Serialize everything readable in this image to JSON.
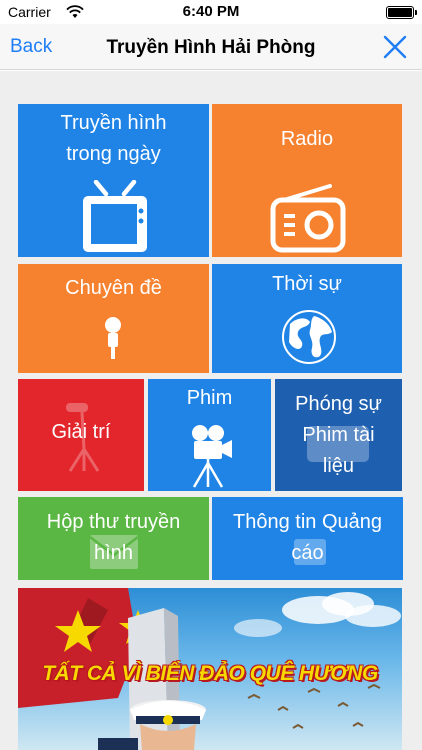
{
  "status_bar": {
    "carrier": "Carrier",
    "time": "6:40 PM"
  },
  "nav": {
    "back_label": "Back",
    "title": "Truyền Hình Hải Phòng",
    "close_icon": "close-icon"
  },
  "tiles": [
    {
      "id": "truyen-hinh-trong-ngay",
      "lines": [
        "Truyền hình",
        "trong ngày"
      ],
      "color": "#2084e6",
      "icon": "tv-icon"
    },
    {
      "id": "radio",
      "lines": [
        "Radio"
      ],
      "color": "#f6822f",
      "icon": "radio-icon"
    },
    {
      "id": "chuyen-de",
      "lines": [
        "Chuyên đề"
      ],
      "color": "#f6822f",
      "icon": "microphone-icon"
    },
    {
      "id": "thoi-su",
      "lines": [
        "Thời sự"
      ],
      "color": "#2084e6",
      "icon": "globe-icon"
    },
    {
      "id": "giai-tri",
      "lines": [
        "Giải trí"
      ],
      "color": "#e3262c",
      "icon": "mic-stand-icon"
    },
    {
      "id": "phim",
      "lines": [
        "Phim"
      ],
      "color": "#2084e6",
      "icon": "movie-camera-icon"
    },
    {
      "id": "phong-su",
      "lines": [
        "Phóng sự",
        "Phim tài",
        "liệu"
      ],
      "color": "#1e5fb0",
      "icon": "hd-icon"
    },
    {
      "id": "hop-thu",
      "lines": [
        "Hộp thư truyền",
        "hình"
      ],
      "color": "#5ab743",
      "icon": "envelope-icon"
    },
    {
      "id": "thong-tin-quang-cao",
      "lines": [
        "Thông tin Quảng",
        "cáo"
      ],
      "color": "#2084e6",
      "icon": "ad-icon"
    }
  ],
  "banner": {
    "caption": "TẤT CẢ VÌ BIỂN ĐẢO QUÊ HƯƠNG"
  }
}
